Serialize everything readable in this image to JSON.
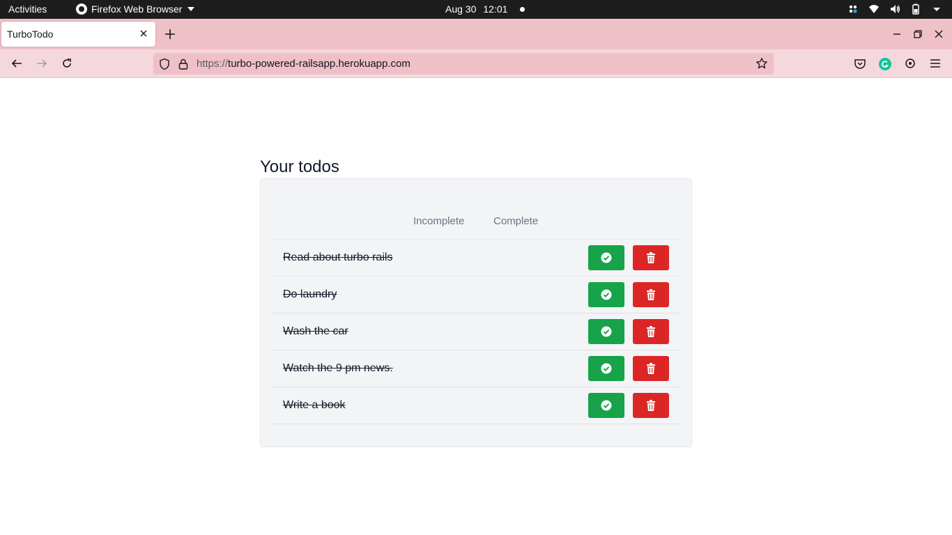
{
  "system_bar": {
    "activities": "Activities",
    "app_name": "Firefox Web Browser",
    "date": "Aug 30",
    "time": "12:01"
  },
  "browser": {
    "tab_title": "TurboTodo",
    "url_scheme": "https://",
    "url_host": "turbo-powered-railsapp.herokuapp.com"
  },
  "page": {
    "heading": "Your todos",
    "filters": [
      "Incomplete",
      "Complete"
    ],
    "todos": [
      {
        "text": "Read about turbo rails",
        "completed": true
      },
      {
        "text": "Do laundry",
        "completed": true
      },
      {
        "text": "Wash the car",
        "completed": true
      },
      {
        "text": "Watch the 9 pm news.",
        "completed": true
      },
      {
        "text": "Write a book",
        "completed": true
      }
    ]
  },
  "colors": {
    "complete_button": "#16a34a",
    "delete_button": "#dc2626",
    "tab_strip": "#f0c0c8",
    "nav_bar": "#f4d8dd",
    "card_background": "#f3f4f6"
  },
  "icons": {
    "complete": "check-circle-icon",
    "delete": "trash-icon"
  }
}
